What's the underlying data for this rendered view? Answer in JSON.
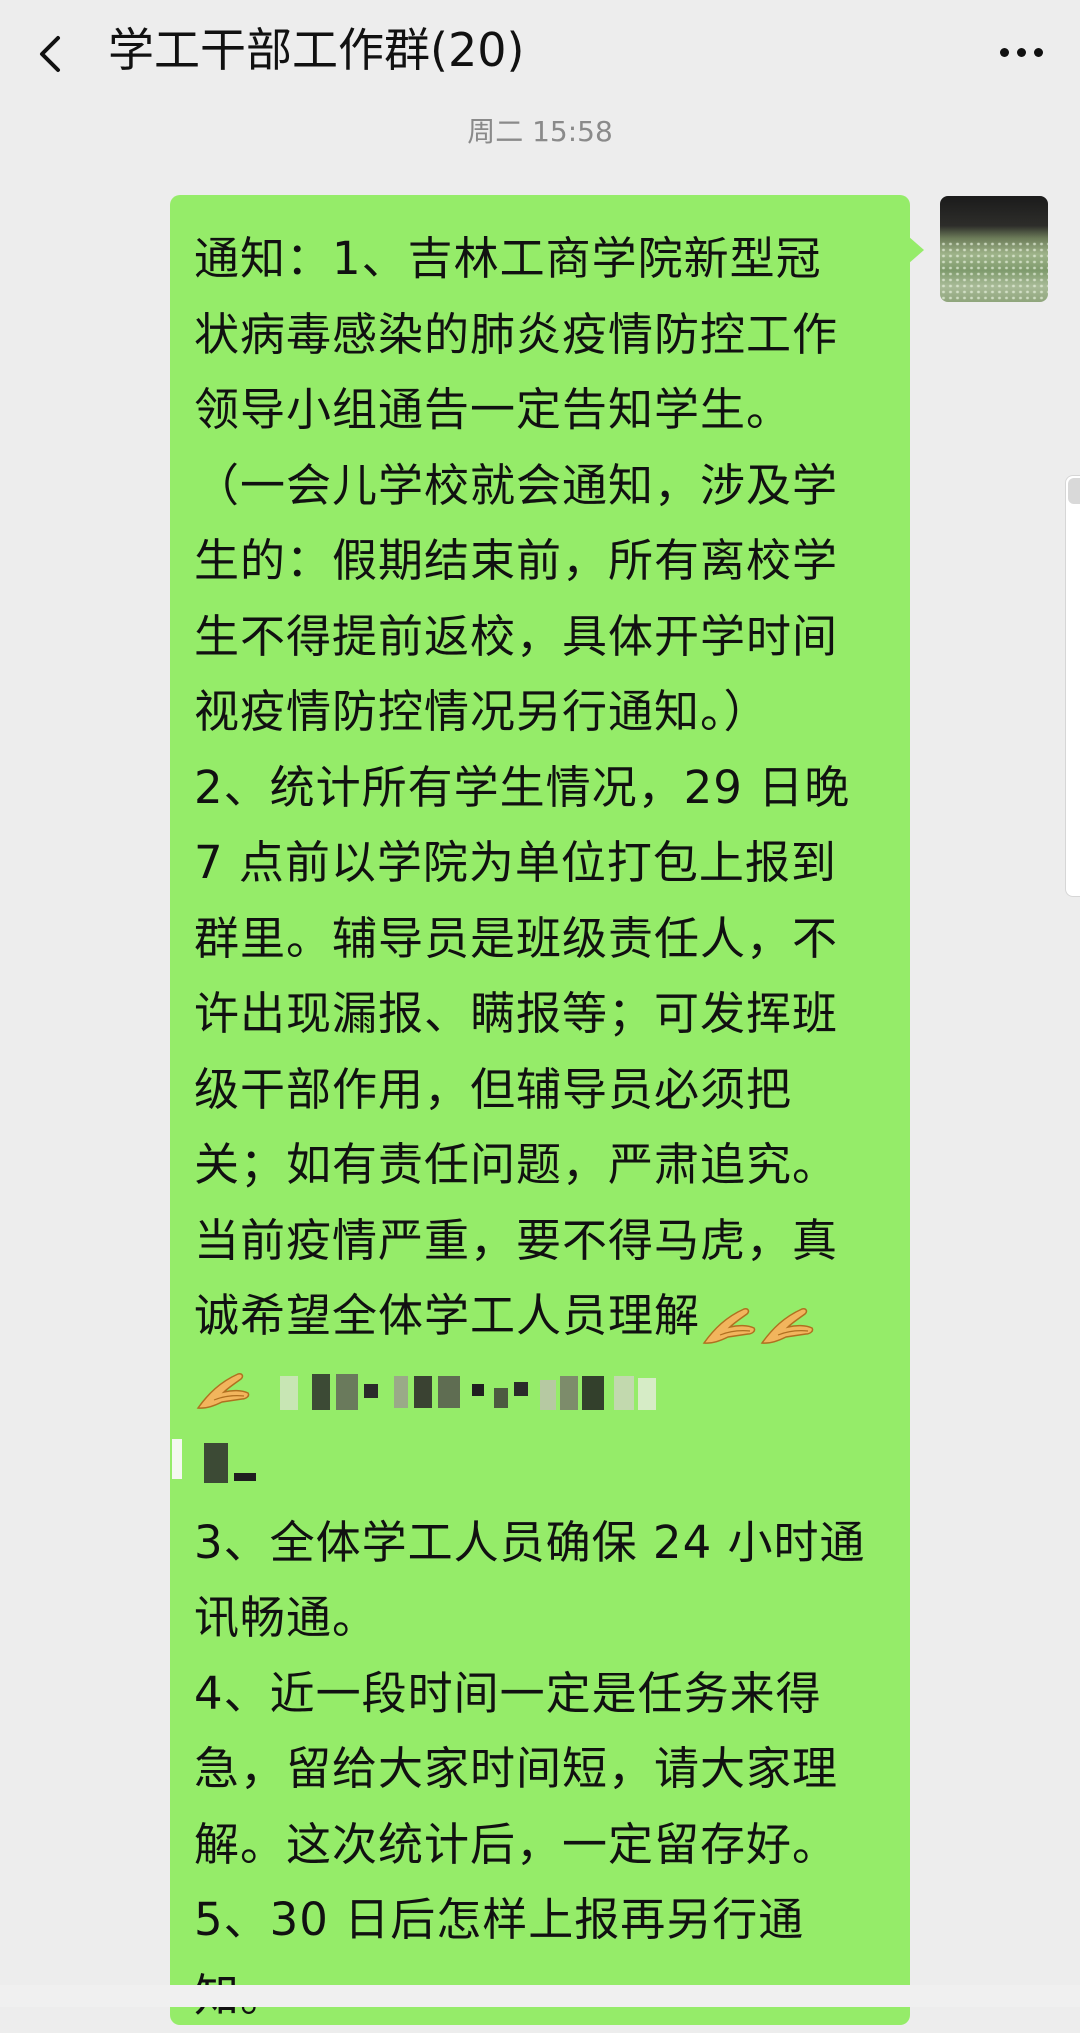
{
  "header": {
    "title": "学工干部工作群(20)",
    "back_icon": "chevron-left-icon",
    "more_icon": "more-dots-icon"
  },
  "timestamp": "周二 15:58",
  "message": {
    "lines_before_emoji": [
      "通知：1、吉林工商学院新型冠",
      "状病毒感染的肺炎疫情防控工作",
      "领导小组通告一定告知学生。",
      "（一会儿学校就会通知，涉及学",
      "生的：假期结束前，所有离校学",
      "生不得提前返校，具体开学时间",
      "视疫情防控情况另行通知。）",
      "2、统计所有学生情况，29 日晚",
      "7 点前以学院为单位打包上报到",
      "群里。辅导员是班级责任人，不",
      "许出现漏报、瞒报等；可发挥班",
      "级干部作用，但辅导员必须把",
      "关；如有责任问题，严肃追究。",
      "当前疫情严重，要不得马虎，真"
    ],
    "emoji_line_text": "诚希望全体学工人员理解",
    "lines_after_emoji": [
      "3、全体学工人员确保 24 小时通",
      "讯畅通。",
      "4、近一段时间一定是任务来得",
      "急，留给大家时间短，请大家理",
      "解。这次统计后，一定留存好。",
      "5、30 日后怎样上报再另行通",
      "知。"
    ],
    "emoji_icon": "folded-hands-icon",
    "bubble_color": "#95ec69"
  }
}
